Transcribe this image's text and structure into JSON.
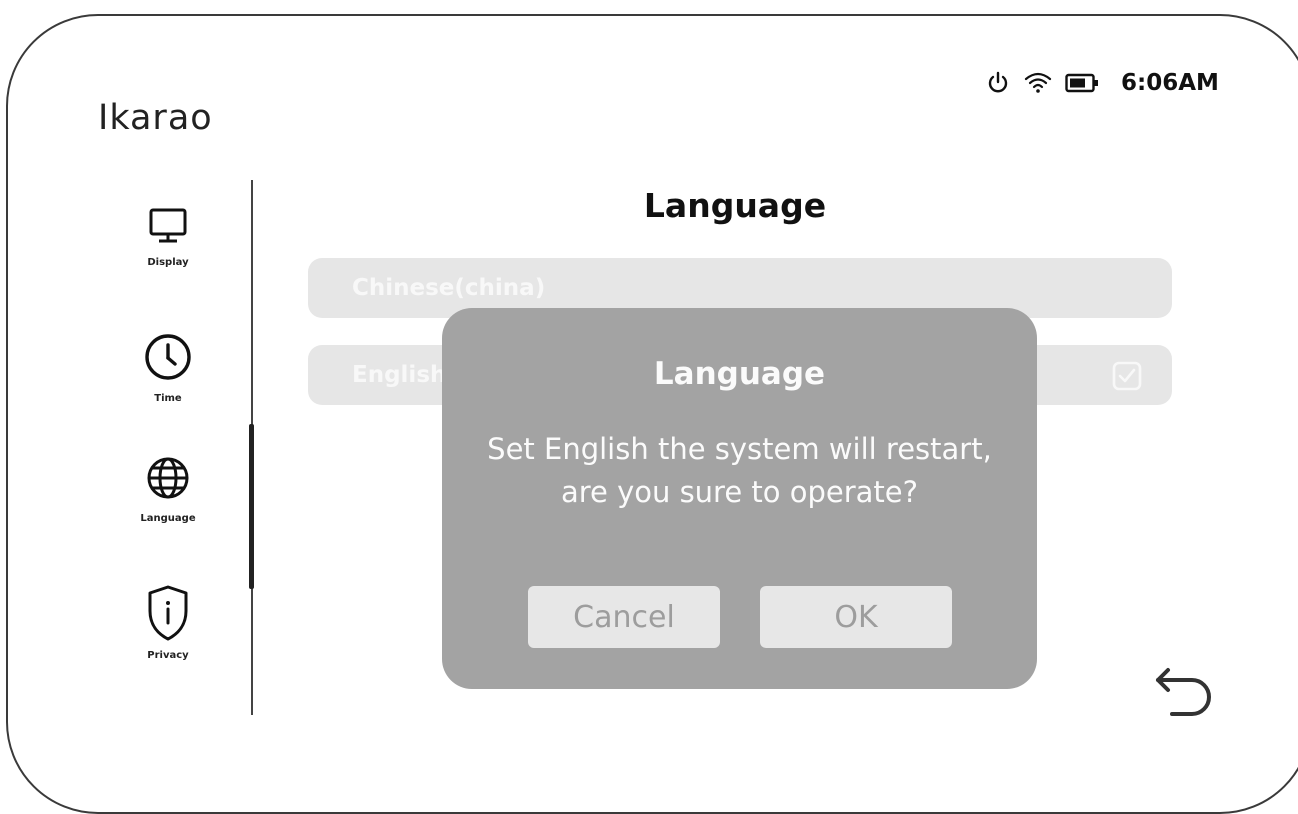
{
  "app": {
    "brand": "Ikarao"
  },
  "status": {
    "time": "6:06AM"
  },
  "sidebar": {
    "items": [
      {
        "label": "Display",
        "icon": "monitor-icon"
      },
      {
        "label": "Time",
        "icon": "clock-icon"
      },
      {
        "label": "Language",
        "icon": "globe-icon"
      },
      {
        "label": "Privacy",
        "icon": "shield-info-icon"
      }
    ]
  },
  "main": {
    "title": "Language",
    "options": [
      {
        "label": "Chinese(china)",
        "selected": false
      },
      {
        "label": "English",
        "selected": true
      }
    ]
  },
  "dialog": {
    "title": "Language",
    "message": "Set English the system will restart, are you sure to operate?",
    "cancel_label": "Cancel",
    "ok_label": "OK"
  }
}
